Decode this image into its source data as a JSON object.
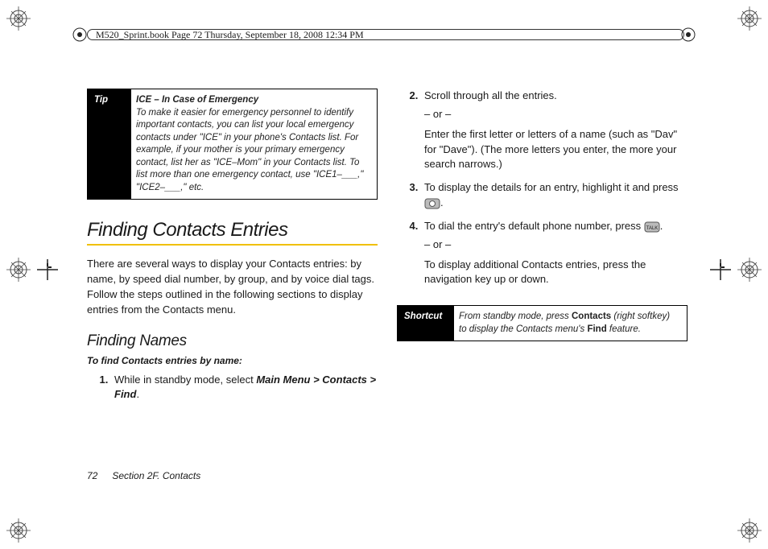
{
  "header": {
    "running_head": "M520_Sprint.book  Page 72  Thursday, September 18, 2008  12:34 PM"
  },
  "footer": {
    "page_number": "72",
    "section_label": "Section 2F. Contacts"
  },
  "tipbox": {
    "label": "Tip",
    "title": "ICE – In Case of Emergency",
    "body": "To make it easier for emergency personnel to identify important contacts, you can list your local emergency contacts under \"ICE\" in your phone's Contacts list. For example, if your mother is your primary emergency contact, list her as \"ICE–Mom\" in your Contacts list. To list more than one emergency contact, use ",
    "code1": "\"ICE1–___,\" \"ICE2–___,\"",
    "etc": " etc."
  },
  "section_title": "Finding Contacts Entries",
  "intro": "There are several ways to display your Contacts entries: by name, by speed dial number, by group, and by voice dial tags. Follow the steps outlined in the following sections to display entries from the Contacts menu.",
  "subhead": "Finding Names",
  "caption": "To find Contacts entries by name:",
  "step1_pre": "While in standby mode, select ",
  "step1_path": "Main Menu > Contacts > Find",
  "step1_post": ".",
  "step2a": "Scroll through all the entries.",
  "or_dash": "– or –",
  "step2b": "Enter the first letter or letters of a name (such as \"Dav\" for \"Dave\"). (The more letters you enter, the more your search narrows.)",
  "step3_pre": "To display the details for an entry, highlight it and press ",
  "step3_post": ".",
  "step4a_pre": "To dial the entry's default phone number, press ",
  "step4a_post": ".",
  "step4b": "To display additional Contacts entries, press the navigation key up or down.",
  "shortcut": {
    "label": "Shortcut",
    "body_pre": "From standby mode, press ",
    "contacts": "Contacts",
    "body_mid": " (right softkey) to display the Contacts menu's ",
    "find": "Find",
    "body_post": " feature."
  }
}
